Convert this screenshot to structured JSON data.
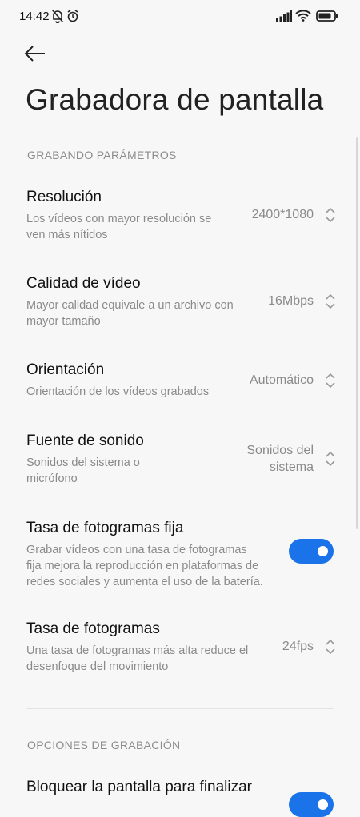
{
  "status_bar": {
    "time": "14:42",
    "icons": [
      "bell-off-icon",
      "alarm-icon",
      "signal-icon",
      "wifi-icon",
      "battery-icon"
    ]
  },
  "header": {
    "back_icon": "arrow-left-icon",
    "title": "Grabadora de pantalla"
  },
  "sections": [
    {
      "label": "GRABANDO PARÁMETROS"
    },
    {
      "label": "OPCIONES DE GRABACIÓN"
    }
  ],
  "settings": [
    {
      "title": "Resolución",
      "desc_lines": [
        "Los vídeos con mayor resolución se",
        "ven más nítidos"
      ],
      "value": "2400*1080"
    },
    {
      "title": "Calidad de vídeo",
      "desc_lines": [
        "Mayor calidad equivale a un archivo con",
        "mayor tamaño"
      ],
      "value": "16Mbps"
    },
    {
      "title": "Orientación",
      "desc_lines": [
        "Orientación de los vídeos grabados"
      ],
      "value": "Automático"
    },
    {
      "title": "Fuente de sonido",
      "desc_lines": [
        "Sonidos del sistema o",
        "micrófono"
      ],
      "value_lines": [
        "Sonidos del",
        "sistema"
      ]
    },
    {
      "title": "Tasa de fotogramas fija",
      "desc_lines": [
        "Grabar vídeos con una tasa de fotogramas",
        "fija mejora la reproducción en plataformas de",
        "redes sociales y aumenta el uso de la batería."
      ],
      "toggle_on": true
    },
    {
      "title": "Tasa de fotogramas",
      "desc_lines": [
        "Una tasa de fotogramas más alta reduce el",
        "desenfoque del movimiento"
      ],
      "value": "24fps"
    },
    {
      "title": "Bloquear la pantalla para finalizar",
      "toggle_on": true
    }
  ],
  "colors": {
    "accent": "#1a73e8",
    "background": "#f7f7f7",
    "secondary_text": "#8a8a8a"
  }
}
